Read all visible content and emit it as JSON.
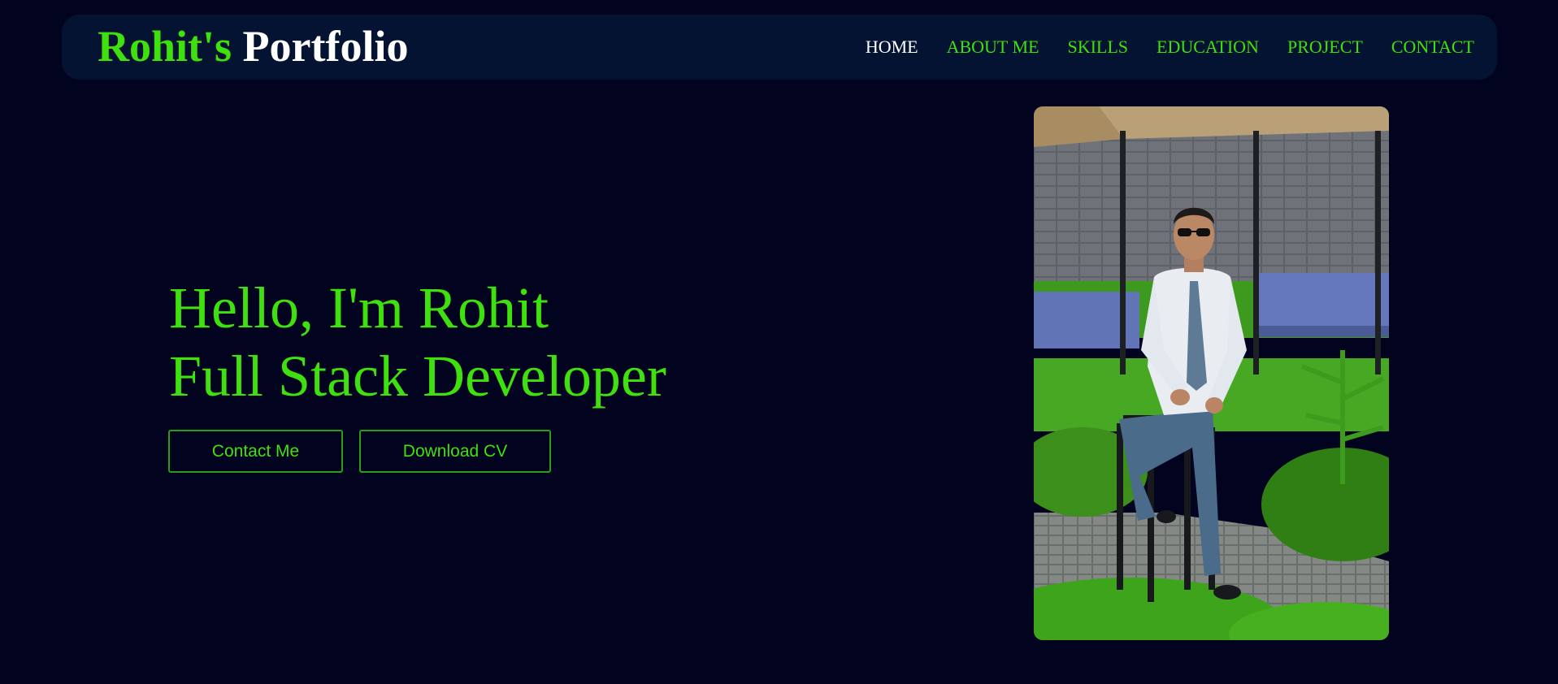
{
  "header": {
    "logo_accent": "Rohit's",
    "logo_rest": "Portfolio",
    "nav": [
      {
        "label": "HOME",
        "active": true
      },
      {
        "label": "ABOUT ME",
        "active": false
      },
      {
        "label": "SKILLS",
        "active": false
      },
      {
        "label": "EDUCATION",
        "active": false
      },
      {
        "label": "PROJECT",
        "active": false
      },
      {
        "label": "CONTACT",
        "active": false
      }
    ]
  },
  "hero": {
    "greeting": "Hello, I'm Rohit",
    "role": "Full Stack Developer",
    "buttons": {
      "contact": "Contact Me",
      "download_cv": "Download CV"
    },
    "photo": {
      "subject": "portrait-photo"
    }
  },
  "colors": {
    "background": "#02031f",
    "navbar": "#051332",
    "accent": "#3ee10e",
    "text_white": "#ffffff"
  }
}
